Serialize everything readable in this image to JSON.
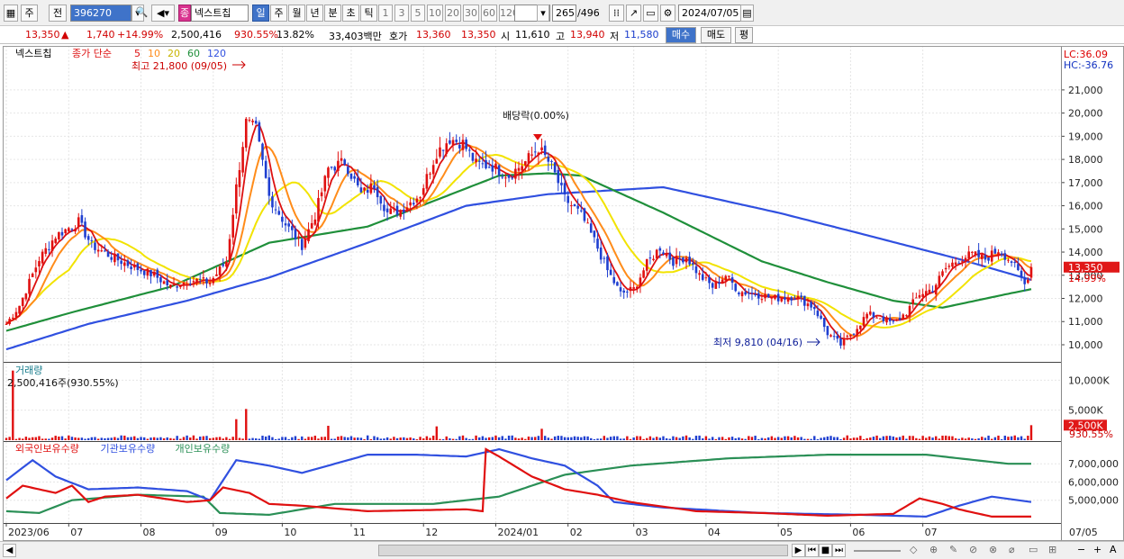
{
  "toolbar": {
    "market": "주",
    "prev": "전",
    "code": "396270",
    "stock_badge": "종",
    "stock_name": "넥스트칩",
    "periods": [
      "일",
      "주",
      "월",
      "년",
      "분",
      "초",
      "틱"
    ],
    "active_period": "일",
    "intervals": [
      "1",
      "3",
      "5",
      "10",
      "20",
      "30",
      "60",
      "120"
    ],
    "count": "265",
    "total": "/496",
    "date": "2024/07/05"
  },
  "quote": {
    "price": "13,350",
    "arrow": "▲",
    "change": "1,740",
    "change_pct": "+14.99%",
    "volume": "2,500,416",
    "vol_pct": "930.55%",
    "turnover": "13.82%",
    "amount": "33,403백만",
    "hoga_label": "호가",
    "ask": "13,360",
    "bid": "13,350",
    "open_label": "시",
    "open": "11,610",
    "high_label": "고",
    "high": "13,940",
    "low_label": "저",
    "low": "11,580",
    "buy": "매수",
    "sell": "매도",
    "avg": "평"
  },
  "chart_data": {
    "type": "line",
    "price_panel": {
      "name_label": "넥스트칩",
      "ma_legend": {
        "label": "종가 단순",
        "periods": [
          "5",
          "10",
          "20",
          "60",
          "120"
        ],
        "colors": [
          "#dd1111",
          "#ff8c1a",
          "#f2e300",
          "#1f8f3a",
          "#3050e0"
        ]
      },
      "y_ticks": [
        21000,
        20000,
        19000,
        18000,
        17000,
        16000,
        15000,
        14000,
        13000,
        12000,
        11000,
        10000
      ],
      "y_tick_labels": [
        "21,000",
        "20,000",
        "19,000",
        "18,000",
        "17,000",
        "16,000",
        "15,000",
        "14,000",
        "13,000",
        "12,000",
        "11,000",
        "10,000"
      ],
      "ylim": [
        9300,
        22200
      ],
      "high_annotation": "최고 21,800 (09/05)",
      "low_annotation": "최저 9,810 (04/16)",
      "dividend_annotation": "배당락(0.00%)",
      "lc": "LC:36.09",
      "hc": "HC:-36.76",
      "current_price_label": "13,350",
      "current_pct_label": "14.99%",
      "close_keypoints": [
        [
          0,
          10900
        ],
        [
          4,
          11700
        ],
        [
          10,
          13700
        ],
        [
          15,
          14700
        ],
        [
          22,
          15300
        ],
        [
          26,
          14300
        ],
        [
          32,
          13800
        ],
        [
          38,
          13400
        ],
        [
          45,
          13000
        ],
        [
          50,
          12500
        ],
        [
          56,
          12800
        ],
        [
          62,
          12700
        ],
        [
          67,
          13600
        ],
        [
          70,
          16800
        ],
        [
          73,
          19600
        ],
        [
          76,
          19300
        ],
        [
          80,
          16400
        ],
        [
          85,
          15200
        ],
        [
          90,
          14300
        ],
        [
          94,
          15600
        ],
        [
          98,
          17600
        ],
        [
          103,
          17900
        ],
        [
          108,
          16500
        ],
        [
          112,
          16900
        ],
        [
          116,
          15700
        ],
        [
          120,
          15800
        ],
        [
          126,
          16500
        ],
        [
          131,
          18300
        ],
        [
          135,
          18900
        ],
        [
          139,
          18700
        ],
        [
          143,
          17800
        ],
        [
          148,
          17700
        ],
        [
          153,
          17300
        ],
        [
          158,
          17900
        ],
        [
          162,
          18500
        ],
        [
          166,
          17700
        ],
        [
          170,
          16300
        ],
        [
          175,
          15600
        ],
        [
          179,
          14500
        ],
        [
          183,
          13200
        ],
        [
          187,
          12200
        ],
        [
          191,
          12400
        ],
        [
          195,
          13500
        ],
        [
          199,
          14200
        ],
        [
          203,
          13600
        ],
        [
          207,
          13800
        ],
        [
          211,
          13000
        ],
        [
          215,
          12500
        ],
        [
          219,
          13000
        ],
        [
          223,
          12300
        ],
        [
          228,
          12200
        ],
        [
          234,
          12000
        ],
        [
          240,
          12100
        ],
        [
          246,
          11600
        ],
        [
          250,
          10500
        ],
        [
          254,
          10000
        ],
        [
          258,
          10600
        ],
        [
          262,
          11300
        ],
        [
          266,
          11200
        ],
        [
          270,
          10900
        ],
        [
          274,
          11400
        ],
        [
          278,
          12200
        ],
        [
          282,
          12400
        ],
        [
          286,
          13300
        ],
        [
          290,
          13700
        ],
        [
          294,
          13900
        ],
        [
          298,
          13700
        ],
        [
          302,
          14100
        ],
        [
          306,
          13600
        ],
        [
          310,
          12600
        ],
        [
          312,
          13350
        ]
      ],
      "ma60_keypoints": [
        [
          0,
          10600
        ],
        [
          20,
          11400
        ],
        [
          50,
          12500
        ],
        [
          80,
          14400
        ],
        [
          110,
          15100
        ],
        [
          150,
          17300
        ],
        [
          165,
          17400
        ],
        [
          175,
          17300
        ],
        [
          200,
          15700
        ],
        [
          230,
          13600
        ],
        [
          250,
          12700
        ],
        [
          270,
          11900
        ],
        [
          285,
          11600
        ],
        [
          305,
          12200
        ],
        [
          312,
          12400
        ]
      ],
      "ma120_keypoints": [
        [
          0,
          9800
        ],
        [
          25,
          10900
        ],
        [
          55,
          11900
        ],
        [
          80,
          12900
        ],
        [
          110,
          14400
        ],
        [
          140,
          16000
        ],
        [
          165,
          16500
        ],
        [
          200,
          16800
        ],
        [
          235,
          15700
        ],
        [
          260,
          14800
        ],
        [
          290,
          13700
        ],
        [
          312,
          12800
        ]
      ]
    },
    "volume_panel": {
      "title": "거래량",
      "last_label": "2,500,416주(930.55%)",
      "y_tick_labels": [
        "10,000K",
        "5,000K"
      ],
      "y_ticks": [
        10000,
        5000
      ],
      "ylim": [
        0,
        12000
      ],
      "current_label": "2,500K",
      "current_pct": "930.55%",
      "unit": "K",
      "spikes": [
        [
          2,
          11600
        ],
        [
          70,
          3500
        ],
        [
          73,
          5200
        ],
        [
          98,
          2400
        ],
        [
          131,
          2300
        ],
        [
          163,
          1900
        ],
        [
          312,
          2500
        ]
      ]
    },
    "holdings_panel": {
      "legend": [
        "외국인보유수량",
        "기관보유수량",
        "개인보유수량"
      ],
      "colors": [
        "#e01010",
        "#3050e0",
        "#2a8f56"
      ],
      "y_tick_labels": [
        "7,000,000",
        "6,000,000",
        "5,000,000"
      ],
      "y_ticks": [
        7000000,
        6000000,
        5000000
      ],
      "ylim": [
        3800000,
        8000000
      ],
      "foreign_keypoints": [
        [
          0,
          5100
        ],
        [
          5,
          5800
        ],
        [
          15,
          5400
        ],
        [
          20,
          5800
        ],
        [
          25,
          4900
        ],
        [
          30,
          5200
        ],
        [
          40,
          5300
        ],
        [
          55,
          4900
        ],
        [
          62,
          5000
        ],
        [
          66,
          5700
        ],
        [
          74,
          5400
        ],
        [
          80,
          4800
        ],
        [
          90,
          4700
        ],
        [
          110,
          4400
        ],
        [
          140,
          4500
        ],
        [
          145,
          4400
        ],
        [
          146,
          7800
        ],
        [
          150,
          7400
        ],
        [
          160,
          6300
        ],
        [
          170,
          5600
        ],
        [
          180,
          5300
        ],
        [
          190,
          4900
        ],
        [
          210,
          4400
        ],
        [
          230,
          4300
        ],
        [
          250,
          4150
        ],
        [
          270,
          4250
        ],
        [
          278,
          5100
        ],
        [
          285,
          4800
        ],
        [
          290,
          4500
        ],
        [
          300,
          4100
        ],
        [
          312,
          4100
        ]
      ],
      "inst_keypoints": [
        [
          0,
          6100
        ],
        [
          8,
          7200
        ],
        [
          15,
          6300
        ],
        [
          25,
          5600
        ],
        [
          40,
          5700
        ],
        [
          55,
          5500
        ],
        [
          62,
          5000
        ],
        [
          70,
          7200
        ],
        [
          80,
          6900
        ],
        [
          90,
          6500
        ],
        [
          110,
          7500
        ],
        [
          125,
          7500
        ],
        [
          140,
          7400
        ],
        [
          150,
          7800
        ],
        [
          160,
          7300
        ],
        [
          170,
          6900
        ],
        [
          180,
          5800
        ],
        [
          185,
          4900
        ],
        [
          200,
          4600
        ],
        [
          230,
          4300
        ],
        [
          260,
          4200
        ],
        [
          280,
          4100
        ],
        [
          290,
          4700
        ],
        [
          300,
          5200
        ],
        [
          312,
          4900
        ]
      ],
      "retail_keypoints": [
        [
          0,
          4400
        ],
        [
          10,
          4300
        ],
        [
          20,
          5000
        ],
        [
          40,
          5300
        ],
        [
          60,
          5200
        ],
        [
          65,
          4300
        ],
        [
          80,
          4200
        ],
        [
          100,
          4800
        ],
        [
          130,
          4800
        ],
        [
          150,
          5200
        ],
        [
          170,
          6400
        ],
        [
          190,
          6900
        ],
        [
          220,
          7300
        ],
        [
          250,
          7500
        ],
        [
          280,
          7500
        ],
        [
          295,
          7200
        ],
        [
          305,
          7000
        ],
        [
          312,
          7000
        ]
      ]
    },
    "x_axis": {
      "labels": [
        "2023/06",
        "07",
        "08",
        "09",
        "10",
        "11",
        "12",
        "2024/01",
        "02",
        "03",
        "04",
        "05",
        "06",
        "07"
      ],
      "label_bars": [
        0,
        19,
        41,
        63,
        84,
        105,
        127,
        149,
        171,
        191,
        213,
        235,
        257,
        279
      ],
      "right_label": "07/05",
      "n_bars": 313
    }
  },
  "scroll": {
    "buttons": [
      "▶",
      "|◀",
      "◀",
      "■",
      "▶",
      "▶|"
    ],
    "zoom": [
      "−",
      "+",
      "A"
    ]
  }
}
